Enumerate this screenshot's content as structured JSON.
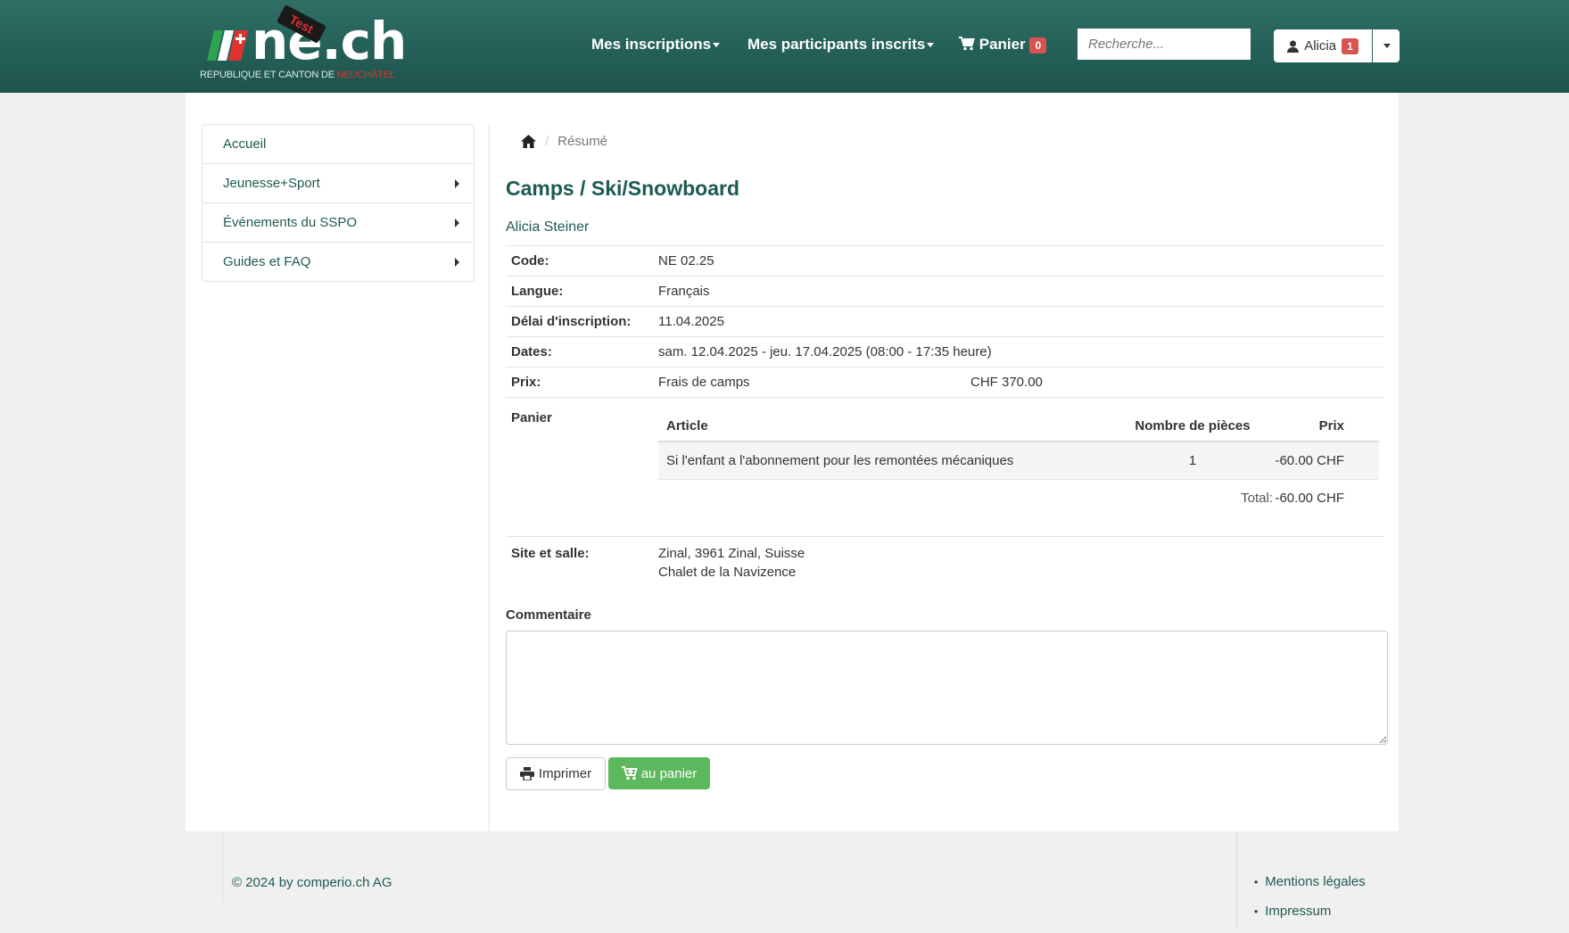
{
  "header": {
    "logo_text": "ne.ch",
    "logo_stamp": "Test",
    "logo_sub": "REPUBLIQUE ET CANTON DE ",
    "logo_sub_red": "NEUCHÂTEL",
    "nav": [
      {
        "label": "Mes inscriptions"
      },
      {
        "label": "Mes participants inscrits"
      },
      {
        "label": "Panier",
        "badge": "0"
      }
    ],
    "search_placeholder": "Recherche...",
    "user": {
      "name": "Alicia",
      "badge": "1"
    }
  },
  "sidebar": {
    "items": [
      {
        "label": "Accueil"
      },
      {
        "label": "Jeunesse+Sport"
      },
      {
        "label": "Événements du SSPO"
      },
      {
        "label": "Guides et FAQ"
      }
    ]
  },
  "breadcrumb": {
    "current": "Résumé"
  },
  "main": {
    "title": "Camps / Ski/Snowboard",
    "person": "Alicia Steiner",
    "fields": {
      "code_label": "Code:",
      "code": "NE 02.25",
      "langue_label": "Langue:",
      "langue": "Français",
      "delai_label": "Délai d'inscription:",
      "delai": "11.04.2025",
      "dates_label": "Dates:",
      "dates": "sam. 12.04.2025 - jeu. 17.04.2025 (08:00 - 17:35 heure)",
      "prix_label": "Prix:",
      "prix_item": "Frais de camps",
      "prix_amount": "CHF 370.00"
    },
    "cart": {
      "label": "Panier",
      "headers": {
        "article": "Article",
        "qty": "Nombre de pièces",
        "price": "Prix"
      },
      "rows": [
        {
          "article": "Si l'enfant a l'abonnement pour les remontées mécaniques",
          "qty": "1",
          "price": "-60.00 CHF"
        }
      ],
      "total_label": "Total:",
      "total": "-60.00 CHF"
    },
    "site": {
      "label": "Site et salle:",
      "line1": "Zinal, 3961 Zinal, Suisse",
      "line2": "Chalet de la Navizence"
    },
    "comment_label": "Commentaire",
    "buttons": {
      "print": "Imprimer",
      "cart": "au panier"
    }
  },
  "footer": {
    "copyright": "© 2024 by comperio.ch AG",
    "links": [
      "Mentions légales",
      "Impressum"
    ]
  },
  "colors": {
    "header": "#1d534c",
    "accent": "#1d5a52",
    "green_button": "#5cb85c",
    "badge": "#d9534f"
  }
}
